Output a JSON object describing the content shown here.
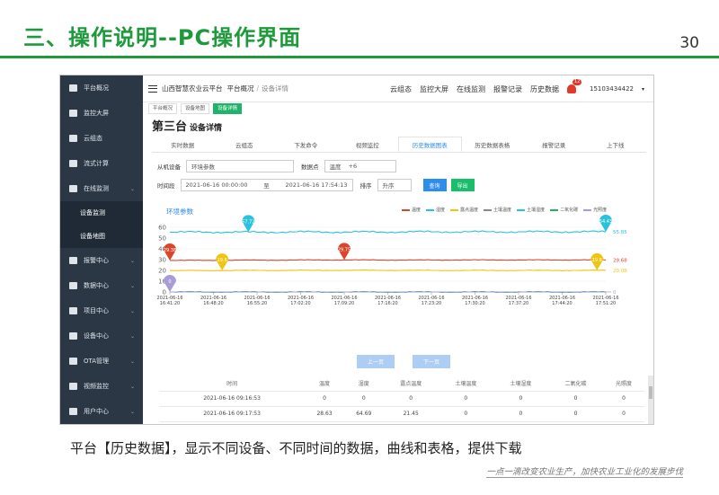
{
  "slide": {
    "title": "三、操作说明--PC操作界面",
    "page": "30",
    "caption": "平台【历史数据】，显示不同设备、不同时间的数据，曲线和表格，提供下载",
    "slogan": "一点一滴改变农业生产，加快农业工业化的发展步伐"
  },
  "app": {
    "name": "山西智慧农业云平台",
    "breadcrumb": [
      "平台概况",
      "设备详情"
    ],
    "topnav": [
      "云组态",
      "监控大屏",
      "在线监测",
      "报警记录",
      "历史数据"
    ],
    "alert_count": "12",
    "user": "15103434422"
  },
  "sidebar": {
    "items": [
      {
        "label": "平台概况",
        "icon": "dashboard-icon"
      },
      {
        "label": "监控大屏",
        "icon": "monitor-icon"
      },
      {
        "label": "云组态",
        "icon": "cloud-icon"
      },
      {
        "label": "流式计算",
        "icon": "compute-icon"
      },
      {
        "label": "在线监测",
        "icon": "chart-line-icon"
      }
    ],
    "subitems": [
      "设备监测",
      "设备地图"
    ],
    "items2": [
      {
        "label": "报警中心",
        "icon": "bell-icon"
      },
      {
        "label": "数据中心",
        "icon": "bar-chart-icon"
      },
      {
        "label": "项目中心",
        "icon": "grid-icon"
      },
      {
        "label": "设备中心",
        "icon": "device-icon"
      },
      {
        "label": "OTA管理",
        "icon": "ota-icon"
      },
      {
        "label": "视频监控",
        "icon": "video-icon"
      },
      {
        "label": "用户中心",
        "icon": "user-icon"
      }
    ]
  },
  "tabs": [
    "平台概况",
    "设备地图",
    "设备详情"
  ],
  "page": {
    "title": "第三台",
    "subtitle": "设备详情"
  },
  "data_tabs": [
    "实时数据",
    "云组态",
    "下发命令",
    "视频监控",
    "历史数据图表",
    "历史数据表格",
    "报警记录",
    "上下线"
  ],
  "filters": {
    "device_label": "从机设备",
    "device_value": "环境参数",
    "point_label": "数据点",
    "point_value": "温度",
    "point_more": "+6",
    "time_label": "时间段",
    "time_start": "2021-06-16 00:00:00",
    "time_to": "至",
    "time_end": "2021-06-16 17:54:13",
    "sort_label": "排序",
    "sort_value": "升序",
    "query": "查询",
    "export": "导出"
  },
  "chart_data": {
    "type": "line",
    "title": "环境参数",
    "x": [
      "2021-06-16 16:41:20",
      "2021-06-16 16:48:20",
      "2021-06-16 16:55:20",
      "2021-06-16 17:02:20",
      "2021-06-16 17:09:20",
      "2021-06-16 17:16:20",
      "2021-06-16 17:23:20",
      "2021-06-16 17:30:20",
      "2021-06-16 17:37:20",
      "2021-06-16 17:44:20",
      "2021-06-16 17:51:20"
    ],
    "ylim": [
      0,
      60
    ],
    "yticks": [
      0,
      10,
      20,
      30,
      40,
      50,
      60
    ],
    "series": [
      {
        "name": "温度",
        "color": "#d9462b",
        "values": [
          29.2,
          29.4,
          29.5,
          29.6,
          29.7,
          29.6,
          29.6,
          29.7,
          29.7,
          29.7,
          29.68
        ],
        "markers": [
          {
            "x": 0,
            "label": "29.38"
          },
          {
            "x": 4,
            "label": "29.75"
          }
        ],
        "end": "29.68"
      },
      {
        "name": "湿度",
        "color": "#29c2dc",
        "values": [
          55.5,
          55.6,
          55.5,
          55.7,
          55.6,
          55.7,
          55.8,
          55.8,
          55.8,
          55.9,
          55.85
        ],
        "markers": [
          {
            "x": 1.8,
            "label": "57.72"
          },
          {
            "x": 10,
            "label": "54.43"
          }
        ],
        "end": "55.85"
      },
      {
        "name": "露点温度",
        "color": "#f1c40f",
        "values": [
          19.8,
          19.9,
          20.0,
          20.1,
          20.1,
          20.1,
          20.0,
          20.0,
          20.0,
          20.0,
          20.08
        ],
        "markers": [
          {
            "x": 1.2,
            "label": "19.6"
          },
          {
            "x": 9.8,
            "label": "19.6"
          }
        ],
        "end": "20.08"
      },
      {
        "name": "土壤温度",
        "color": "#888888",
        "values": [
          0,
          0,
          0,
          0,
          0,
          0,
          0,
          0,
          0,
          0,
          0
        ]
      },
      {
        "name": "土壤湿度",
        "color": "#29c2dc",
        "values": [
          0,
          0,
          0,
          0,
          0,
          0,
          0,
          0,
          0,
          0,
          0
        ]
      },
      {
        "name": "二氧化碳",
        "color": "#27ae60",
        "values": [
          0,
          0,
          0,
          0,
          0,
          0,
          0,
          0,
          0,
          0,
          0
        ]
      },
      {
        "name": "光照度",
        "color": "#a99bd6",
        "values": [
          0,
          0,
          0,
          0,
          0,
          0,
          0,
          0,
          0,
          0,
          0
        ],
        "markers": [
          {
            "x": 0,
            "label": "0"
          }
        ],
        "end": "0"
      }
    ]
  },
  "pager": {
    "prev": "上一页",
    "next": "下一页"
  },
  "table": {
    "headers": [
      "时间",
      "温度",
      "湿度",
      "露点温度",
      "土壤温度",
      "土壤湿度",
      "二氧化碳",
      "光照度"
    ],
    "rows": [
      [
        "2021-06-16 09:16:53",
        "0",
        "0",
        "0",
        "0",
        "0",
        "0",
        "0"
      ],
      [
        "2021-06-16 09:17:53",
        "28.63",
        "64.69",
        "21.45",
        "0",
        "0",
        "0",
        "0"
      ]
    ]
  }
}
